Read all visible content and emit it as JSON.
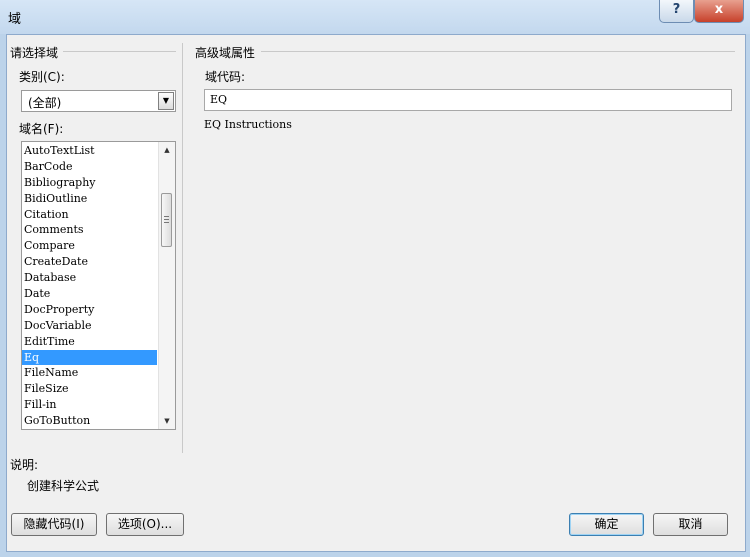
{
  "window": {
    "title": "域",
    "help_label": "?",
    "close_label": "x"
  },
  "left_panel": {
    "group_title": "请选择域",
    "category_label": "类别(C):",
    "category_value": "(全部)",
    "field_names_label": "域名(F):",
    "field_names": [
      "AutoTextList",
      "BarCode",
      "Bibliography",
      "BidiOutline",
      "Citation",
      "Comments",
      "Compare",
      "CreateDate",
      "Database",
      "Date",
      "DocProperty",
      "DocVariable",
      "EditTime",
      "Eq",
      "FileName",
      "FileSize",
      "Fill-in",
      "GoToButton"
    ],
    "selected_field": "Eq"
  },
  "right_panel": {
    "group_title": "高级域属性",
    "field_code_label": "域代码:",
    "field_code_value": "EQ",
    "instructions_text": "EQ Instructions"
  },
  "description": {
    "label": "说明:",
    "text": "创建科学公式"
  },
  "buttons": {
    "hide_codes": "隐藏代码(I)",
    "options": "选项(O)...",
    "ok": "确定",
    "cancel": "取消"
  }
}
